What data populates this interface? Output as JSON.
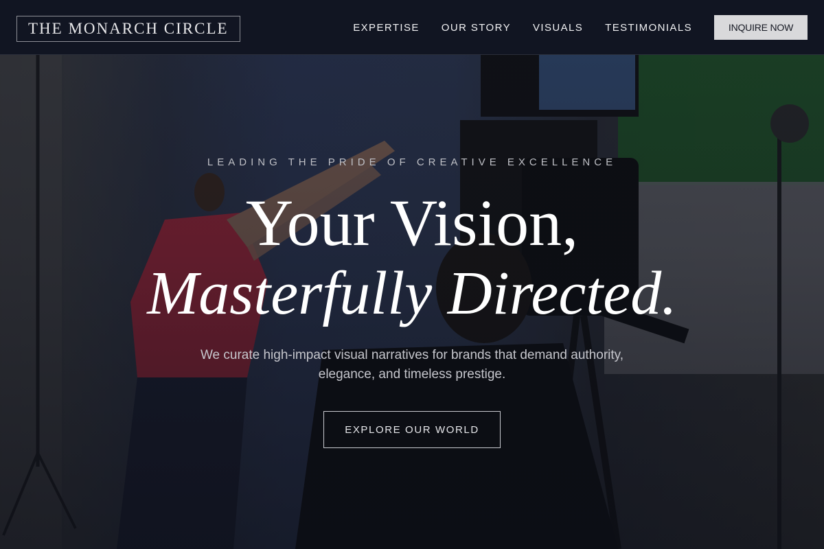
{
  "brand": {
    "logo_text": "THE MONARCH CIRCLE"
  },
  "nav": {
    "items": [
      {
        "label": "EXPERTISE"
      },
      {
        "label": "OUR STORY"
      },
      {
        "label": "VISUALS"
      },
      {
        "label": "TESTIMONIALS"
      }
    ],
    "cta_label": "INQUIRE NOW"
  },
  "hero": {
    "eyebrow": "LEADING THE PRIDE OF CREATIVE EXCELLENCE",
    "headline_line1": "Your Vision,",
    "headline_line2": "Masterfully Directed.",
    "subtitle": "We curate high-impact visual narratives for brands that demand authority, elegance, and timeless prestige.",
    "button_label": "EXPLORE OUR WORLD"
  },
  "colors": {
    "header_bg": "#111522",
    "cta_bg": "#d9d9db",
    "text_primary": "#ffffff",
    "text_muted": "#c6c7cd"
  }
}
